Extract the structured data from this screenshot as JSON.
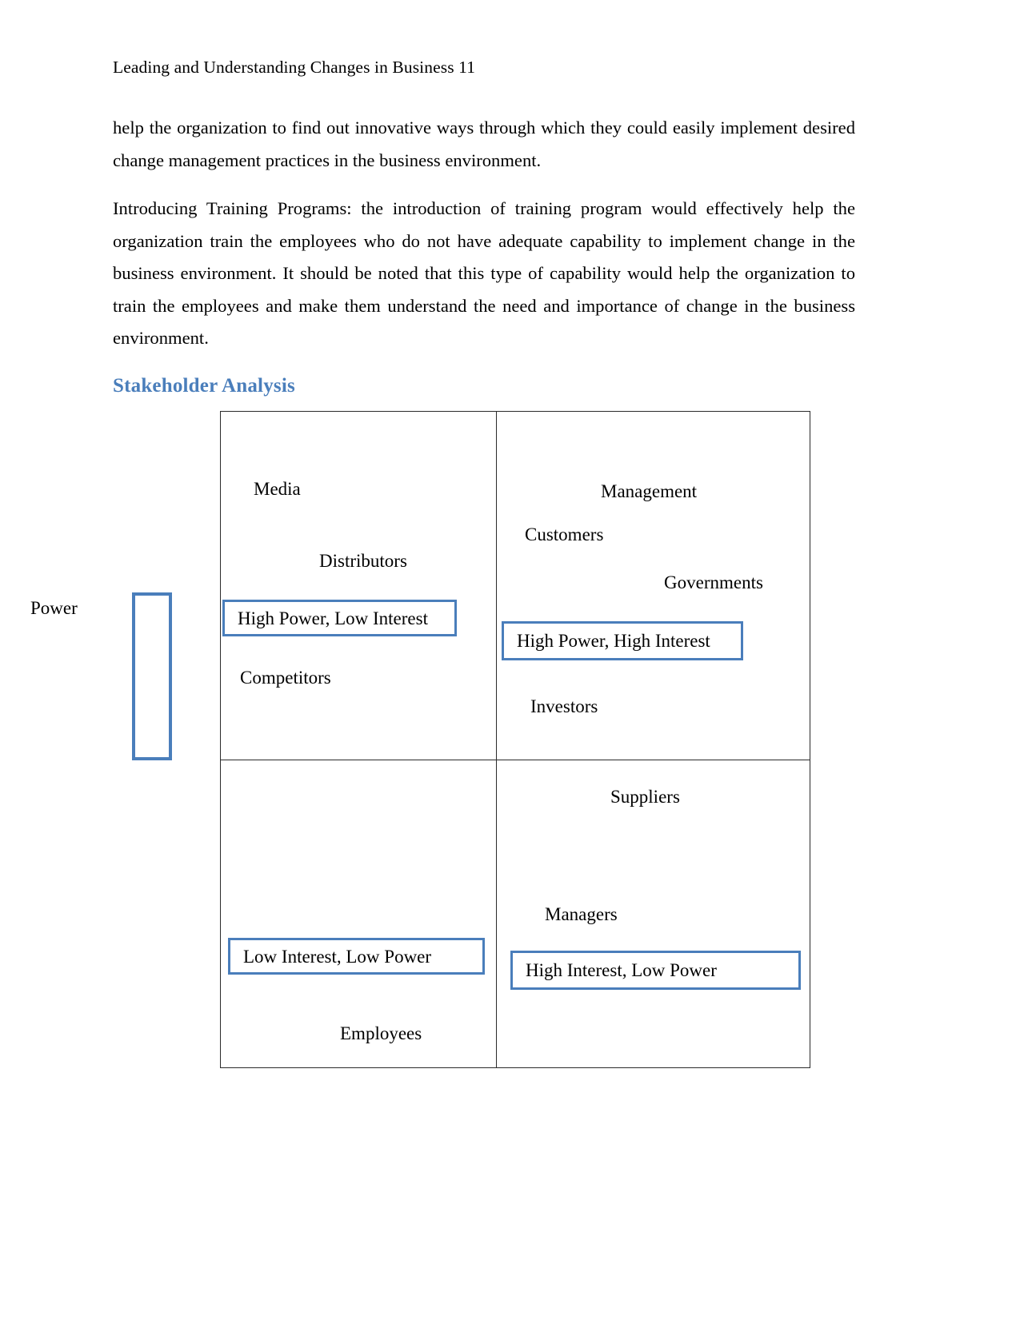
{
  "document": {
    "running_header": "Leading and Understanding Changes in Business 11",
    "paragraphs": [
      "help the organization to find out innovative ways through which they could easily implement desired change management practices in the business environment.",
      "Introducing Training Programs: the introduction of training program would effectively help the organization train the employees who do not have adequate capability to implement change in the business environment. It should be noted that this type of capability would help the organization to train the employees and make them understand the need and importance of change in the business environment."
    ],
    "section_heading": "Stakeholder Analysis"
  },
  "colors": {
    "heading_blue": "#4a7ebb",
    "box_border_blue": "#4a7ebb",
    "grid_line": "#2b2b2b",
    "text": "#000000",
    "page_background": "#ffffff"
  },
  "matrix": {
    "axis": {
      "vertical_label": "Power",
      "vertical_label_wrapped": "P o w er"
    },
    "quadrants": [
      {
        "id": "top-left",
        "caption": "High Power, Low Interest",
        "stakeholders": [
          "Media",
          "Distributors",
          "Competitors"
        ]
      },
      {
        "id": "top-right",
        "caption": "High Power, High Interest",
        "stakeholders": [
          "Management",
          "Customers",
          "Governments",
          "Investors"
        ]
      },
      {
        "id": "bottom-left",
        "caption": "Low Interest, Low Power",
        "stakeholders": [
          "Employees"
        ]
      },
      {
        "id": "bottom-right",
        "caption": "High Interest, Low Power",
        "stakeholders": [
          "Suppliers",
          "Managers"
        ]
      }
    ]
  }
}
